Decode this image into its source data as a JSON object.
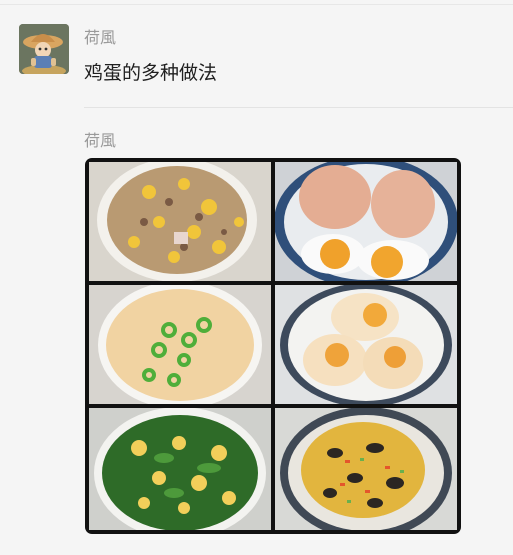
{
  "chat": {
    "messages": [
      {
        "sender": "荷風",
        "text": "鸡蛋的多种做法",
        "avatar_icon": "straw-hat-character-avatar-icon"
      },
      {
        "sender": "荷風",
        "image": {
          "type": "photo-collage",
          "tiles": [
            "egg-fried-rice-photo",
            "boiled-eggs-photo",
            "steamed-egg-custard-photo",
            "fried-eggs-photo",
            "spinach-egg-soup-photo",
            "egg-wood-ear-stir-fry-photo"
          ]
        }
      }
    ]
  },
  "colors": {
    "background": "#f5f5f5",
    "sender_text": "#9a9a9a",
    "message_text": "#1f1f1f",
    "collage_border": "#111111"
  }
}
